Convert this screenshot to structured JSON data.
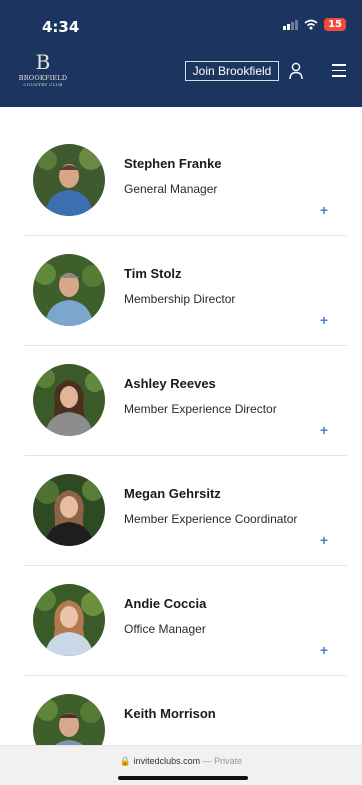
{
  "status_bar": {
    "time": "4:34",
    "battery": "15"
  },
  "header": {
    "logo_mark": "B",
    "logo_name": "BROOKFIELD",
    "logo_sub": "COUNTRY CLUB",
    "join_label": "Join Brookfield"
  },
  "staff": [
    {
      "name": "Stephen Franke",
      "role": "General Manager",
      "expand": "+"
    },
    {
      "name": "Tim Stolz",
      "role": "Membership Director",
      "expand": "+"
    },
    {
      "name": "Ashley Reeves",
      "role": "Member Experience Director",
      "expand": "+"
    },
    {
      "name": "Megan Gehrsitz",
      "role": "Member Experience Coordinator",
      "expand": "+"
    },
    {
      "name": "Andie Coccia",
      "role": "Office Manager",
      "expand": "+"
    },
    {
      "name": "Keith Morrison",
      "role": "",
      "expand": ""
    }
  ],
  "browser": {
    "domain": "invitedclubs.com",
    "privacy": "Private"
  }
}
